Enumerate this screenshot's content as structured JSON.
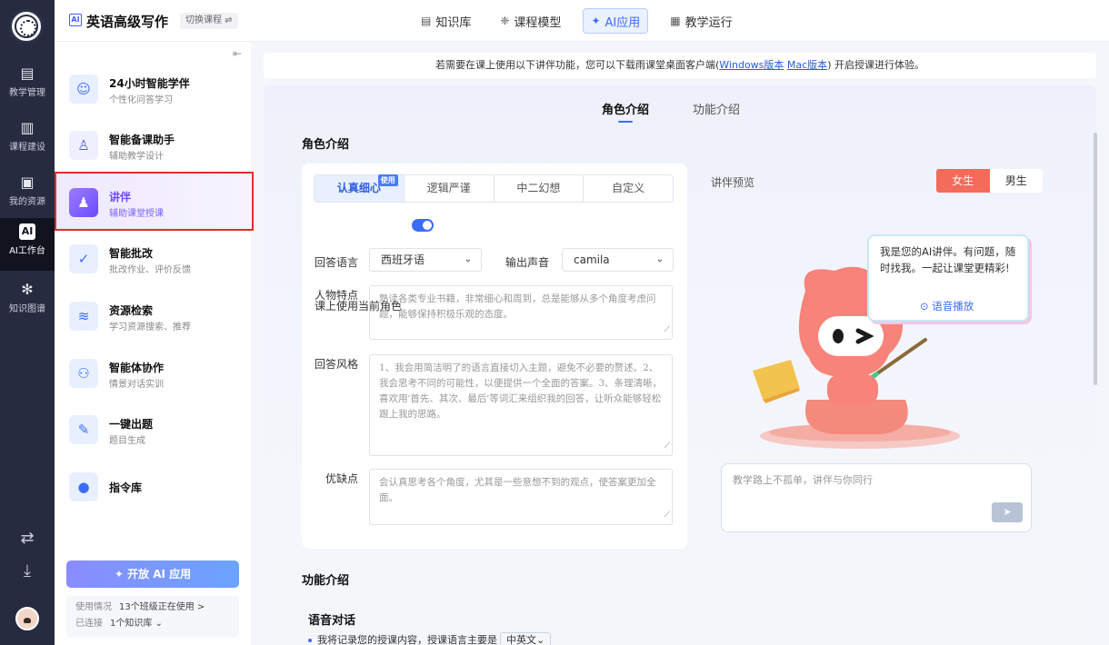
{
  "rail": {
    "items": [
      {
        "label": "教学管理"
      },
      {
        "label": "课程建设"
      },
      {
        "label": "我的资源"
      },
      {
        "label": "AI工作台",
        "icon_text": "AI"
      },
      {
        "label": "知识图谱"
      }
    ]
  },
  "header": {
    "course_title": "英语高级写作",
    "switch_course": "切换课程 ⇌",
    "tabs": [
      {
        "label": "知识库"
      },
      {
        "label": "课程模型"
      },
      {
        "label": "AI应用"
      },
      {
        "label": "教学运行"
      }
    ]
  },
  "sidebar": {
    "items": [
      {
        "title": "24小时智能学伴",
        "sub": "个性化问答学习"
      },
      {
        "title": "智能备课助手",
        "sub": "辅助教学设计"
      },
      {
        "title": "讲伴",
        "sub": "辅助课堂授课"
      },
      {
        "title": "智能批改",
        "sub": "批改作业、评价反馈"
      },
      {
        "title": "资源检索",
        "sub": "学习资源搜索、推荐"
      },
      {
        "title": "智能体协作",
        "sub": "情景对话实训"
      },
      {
        "title": "一键出题",
        "sub": "题目生成"
      },
      {
        "title": "指令库",
        "sub": ""
      }
    ],
    "open_ai_button": "✦ 开放 AI 应用",
    "usage": {
      "usage_label": "使用情况",
      "usage_value": "13个班级正在使用 >",
      "linked_label": "已连接",
      "linked_value": "1个知识库 ⌄"
    }
  },
  "banner": {
    "text_before": "若需要在课上使用以下讲伴功能，您可以下载雨课堂桌面客户端(",
    "windows_link": "Windows版本",
    "mac_link": "Mac版本",
    "text_after": ") 开启授课进行体验。"
  },
  "panel": {
    "tabs": [
      {
        "label": "角色介绍"
      },
      {
        "label": "功能介绍"
      }
    ],
    "role_section_title": "角色介绍",
    "styles": [
      {
        "label": "认真细心",
        "badge": "使用"
      },
      {
        "label": "逻辑严谨"
      },
      {
        "label": "中二幻想"
      },
      {
        "label": "自定义"
      }
    ],
    "use_current_role_label": "课上使用当前角色",
    "use_current_role_on": true,
    "answer_lang_label": "回答语言",
    "answer_lang_value": "西班牙语",
    "voice_label": "输出声音",
    "voice_value": "camila",
    "traits_label": "人物特点",
    "traits_text": "熟读各类专业书籍，非常细心和周到，总是能够从多个角度考虑问题，能够保持积极乐观的态度。",
    "style_label": "回答风格",
    "style_text": "1、我会用简洁明了的语言直接切入主题，避免不必要的赘述。2、我会思考不同的可能性，以便提供一个全面的答案。3、条理清晰，喜欢用'首先、其次、最后'等词汇来组织我的回答，让听众能够轻松跟上我的思路。",
    "pros_label": "优缺点",
    "pros_text": "会认真思考各个角度，尤其是一些意想不到的观点，使答案更加全面。",
    "preview_label": "讲伴预览",
    "gender": [
      {
        "label": "女生"
      },
      {
        "label": "男生"
      }
    ],
    "bubble_text": "我是您的AI讲伴。有问题，随时找我。一起让课堂更精彩!",
    "voice_play": "⊙ 语音播放",
    "chat_placeholder": "教学路上不孤单，讲伴与你同行",
    "func_section_title": "功能介绍",
    "voice_dialog_title": "语音对话",
    "voice_dialog_line": "我将记录您的授课内容，授课语言主要是",
    "voice_dialog_lang": "中英文⌄"
  },
  "colors": {
    "accent": "#3b6cff",
    "active_sidebar": "#6b4bff",
    "female_button": "#f36b5a",
    "highlight_box": "#e02c2c",
    "rail_bg": "#262b40"
  }
}
